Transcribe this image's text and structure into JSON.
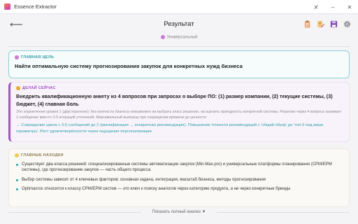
{
  "window": {
    "title": "Essence Extractor"
  },
  "header": {
    "back_icon": "arrow-left-icon",
    "title": "Результат"
  },
  "mode": {
    "label": "Универсальный"
  },
  "goal": {
    "label": "ГЛАВНАЯ ЦЕЛЬ",
    "text": "Найти оптимальную систему прогнозирования закупок для конкретных нужд бизнеса"
  },
  "action": {
    "label": "ДЕЛАЙ СЕЙЧАС",
    "text": "Внедрить квалификационную анкету из 4 вопросов при запросах о выборе ПО: (1) размер компании, (2) текущие системы, (3) бюджет, (4) главная боль",
    "note": "Это ограничение уровня 1 (двустороннее): без контекста бизнеса невозможно ни выбрать класс решения, ни оценить пригодность конкретной системы. Решение через 4 вопроса занимает 1 сообщение вместо 3-5 итераций уточнений. Максимальный выигрыш при сокращении времени до ценности",
    "result": "→ Сокращение цикла с 3-5 сообщений до 2 (квалификация → конкретная рекомендация). Повышение точности рекомендаций с 'общий обзор' до 'топ-3 под ваши параметры'. Рост удовлетворённости через ощущение персонализации"
  },
  "findings": {
    "label": "ГЛАВНЫЕ НАХОДКИ",
    "items": [
      "Существует два класса решений: специализированные системы автоматизации закупок (Min-Max.pro) и универсальные платформы планирования (CPM/EPM системы), где прогнозирование закупок — часть общего процесса",
      "Выбор системы зависит от 4 ключевых факторов: основная задача, интеграция, масштаб бизнеса, методы прогнозирования",
      "Optimacros относится к классу CPM/EPM систем — это ключ к поиску аналогов через категорию продукта, а не через конкретные бренды"
    ]
  },
  "footer": {
    "show_full": "Показать полный анализ",
    "chevron": "▼"
  }
}
